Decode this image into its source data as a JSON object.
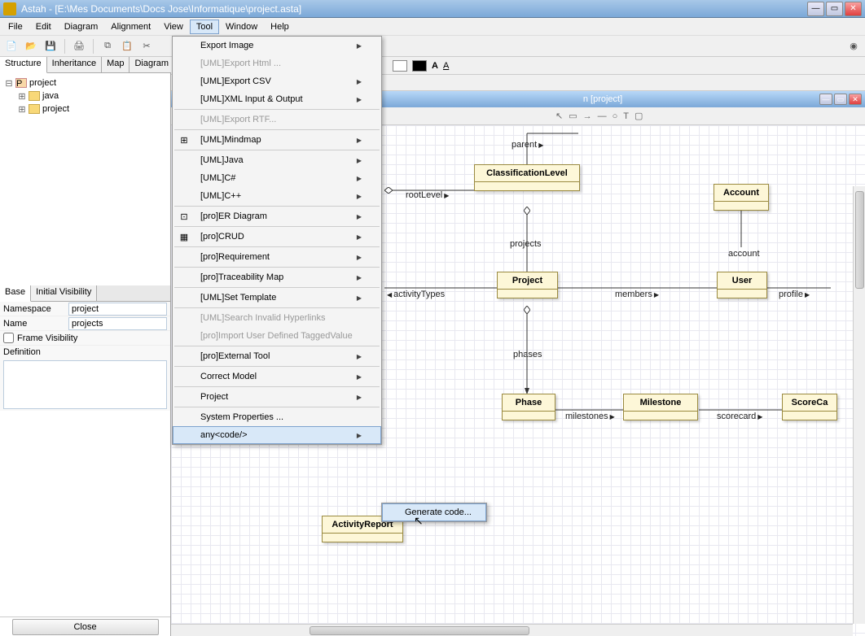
{
  "window": {
    "title": "Astah - [E:\\Mes Documents\\Docs Jose\\Informatique\\project.asta]"
  },
  "menubar": {
    "items": [
      "File",
      "Edit",
      "Diagram",
      "Alignment",
      "View",
      "Tool",
      "Window",
      "Help"
    ],
    "active_index": 5
  },
  "left_tabs": {
    "items": [
      "Structure",
      "Inheritance",
      "Map",
      "Diagram"
    ],
    "active_index": 0
  },
  "tree": {
    "root": "project",
    "children": [
      "java",
      "project"
    ]
  },
  "prop_tabs": {
    "items": [
      "Base",
      "Initial Visibility"
    ],
    "active_index": 0
  },
  "properties": {
    "namespace_label": "Namespace",
    "namespace_value": "project",
    "name_label": "Name",
    "name_value": "projects",
    "frame_visibility_label": "Frame Visibility",
    "definition_label": "Definition",
    "close_label": "Close"
  },
  "doc_tab": {
    "title": "n [project]"
  },
  "tool_menu": {
    "items": [
      {
        "label": "Export Image",
        "arrow": true
      },
      {
        "label": "[UML]Export Html ...",
        "disabled": true
      },
      {
        "label": "[UML]Export CSV",
        "arrow": true
      },
      {
        "label": "[UML]XML Input & Output",
        "arrow": true
      },
      {
        "sep": true
      },
      {
        "label": "[UML]Export RTF...",
        "disabled": true
      },
      {
        "sep": true
      },
      {
        "label": "[UML]Mindmap",
        "arrow": true,
        "icon": "mind"
      },
      {
        "sep": true
      },
      {
        "label": "[UML]Java",
        "arrow": true
      },
      {
        "label": "[UML]C#",
        "arrow": true
      },
      {
        "label": "[UML]C++",
        "arrow": true
      },
      {
        "sep": true
      },
      {
        "label": "[pro]ER Diagram",
        "arrow": true,
        "icon": "er"
      },
      {
        "sep": true
      },
      {
        "label": "[pro]CRUD",
        "arrow": true,
        "icon": "crud"
      },
      {
        "sep": true
      },
      {
        "label": "[pro]Requirement",
        "arrow": true
      },
      {
        "sep": true
      },
      {
        "label": "[pro]Traceability Map",
        "arrow": true
      },
      {
        "sep": true
      },
      {
        "label": "[UML]Set Template",
        "arrow": true
      },
      {
        "sep": true
      },
      {
        "label": "[UML]Search Invalid Hyperlinks",
        "disabled": true
      },
      {
        "label": "[pro]Import User Defined TaggedValue",
        "disabled": true
      },
      {
        "sep": true
      },
      {
        "label": "[pro]External Tool",
        "arrow": true
      },
      {
        "sep": true
      },
      {
        "label": "Correct Model",
        "arrow": true
      },
      {
        "sep": true
      },
      {
        "label": "Project",
        "arrow": true
      },
      {
        "sep": true
      },
      {
        "label": "System Properties ..."
      },
      {
        "label": "any<code/>",
        "arrow": true,
        "highlight": true
      }
    ]
  },
  "submenu": {
    "item": "Generate code..."
  },
  "diagram": {
    "classes": {
      "classification": "ClassificationLevel",
      "account": "Account",
      "project": "Project",
      "user": "User",
      "phase": "Phase",
      "milestone": "Milestone",
      "scorecard": "ScoreCa",
      "activityreport": "ActivityReport"
    },
    "labels": {
      "parent": "parent",
      "rootlevel": "rootLevel",
      "projects": "projects",
      "activitytypes": "activityTypes",
      "members": "members",
      "account": "account",
      "profile": "profile",
      "phases": "phases",
      "milestones": "milestones",
      "scorecard": "scorecard"
    }
  }
}
